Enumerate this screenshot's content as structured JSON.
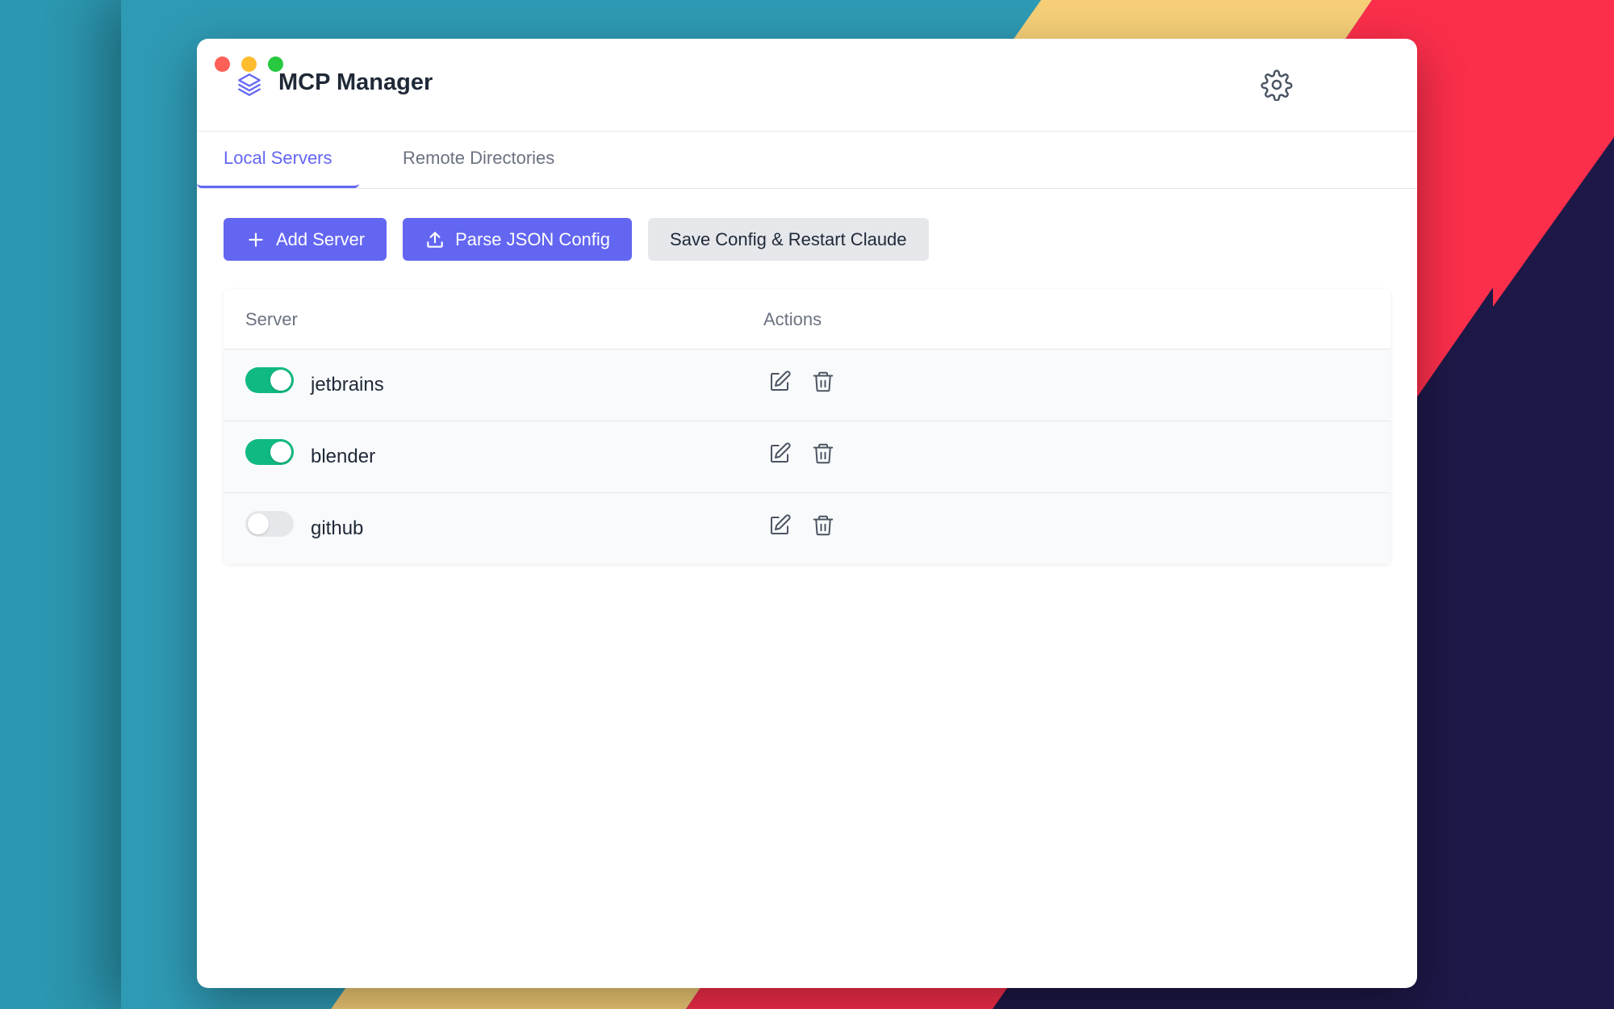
{
  "app": {
    "title": "MCP Manager"
  },
  "window": {
    "controls": [
      "close",
      "minimize",
      "zoom"
    ]
  },
  "icons": {
    "logo": "layers-icon",
    "settings": "gear-icon",
    "add": "plus-icon",
    "parse": "upload-icon",
    "edit": "edit-icon",
    "delete": "trash-icon"
  },
  "tabs": [
    {
      "label": "Local Servers",
      "active": true
    },
    {
      "label": "Remote Directories",
      "active": false
    }
  ],
  "toolbar": {
    "add_label": "Add Server",
    "parse_label": "Parse JSON Config",
    "save_label": "Save Config & Restart Claude"
  },
  "table": {
    "headers": {
      "server": "Server",
      "actions": "Actions"
    },
    "rows": [
      {
        "name": "jetbrains",
        "enabled": true
      },
      {
        "name": "blender",
        "enabled": true
      },
      {
        "name": "github",
        "enabled": false
      }
    ]
  },
  "colors": {
    "accent": "#6366f1",
    "toggle_on": "#10b981",
    "toggle_off": "#e5e7eb",
    "text": "#1f2937",
    "muted": "#6b7280"
  }
}
